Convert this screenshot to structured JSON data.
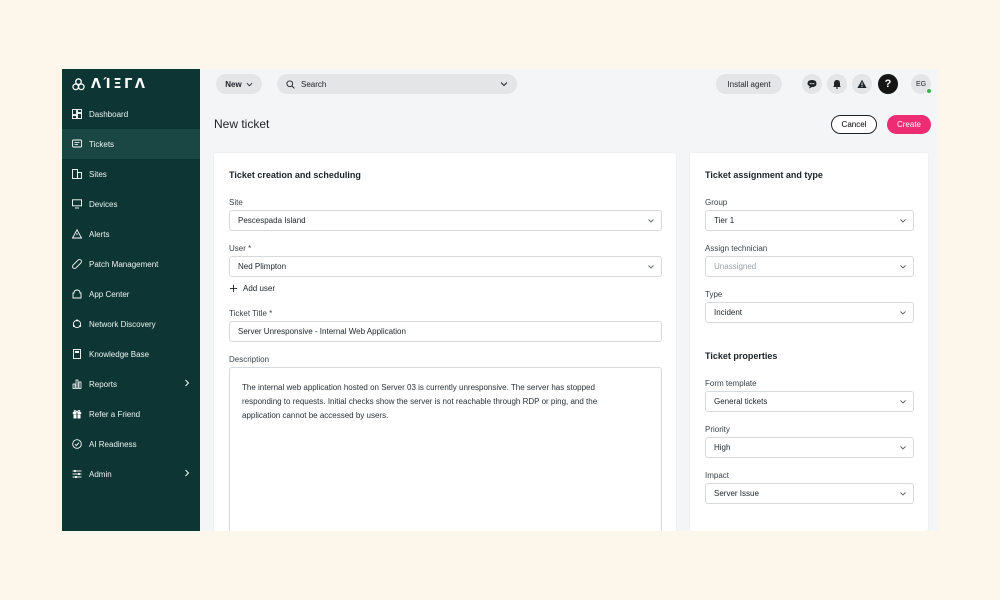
{
  "logo": {
    "text": "ΛΊΞΓΛ"
  },
  "sidebar": {
    "items": [
      {
        "label": "Dashboard",
        "icon": "dashboard-icon"
      },
      {
        "label": "Tickets",
        "icon": "ticket-icon"
      },
      {
        "label": "Sites",
        "icon": "sites-icon"
      },
      {
        "label": "Devices",
        "icon": "monitor-icon"
      },
      {
        "label": "Alerts",
        "icon": "alert-triangle-icon"
      },
      {
        "label": "Patch Management",
        "icon": "bandage-icon"
      },
      {
        "label": "App Center",
        "icon": "app-center-icon"
      },
      {
        "label": "Network Discovery",
        "icon": "network-icon"
      },
      {
        "label": "Knowledge Base",
        "icon": "book-icon"
      },
      {
        "label": "Reports",
        "icon": "reports-icon"
      },
      {
        "label": "Refer a Friend",
        "icon": "gift-icon"
      },
      {
        "label": "AI Readiness",
        "icon": "check-circle-icon"
      },
      {
        "label": "Admin",
        "icon": "sliders-icon"
      }
    ]
  },
  "topbar": {
    "new_label": "New",
    "search_label": "Search",
    "install_label": "Install agent",
    "help_label": "?",
    "avatar_initials": "EG"
  },
  "page": {
    "title": "New ticket",
    "cancel_label": "Cancel",
    "create_label": "Create"
  },
  "left_card": {
    "title": "Ticket creation and scheduling",
    "site_label": "Site",
    "site_value": "Pescespada Island",
    "user_label": "User *",
    "user_value": "Ned Plimpton",
    "add_user_label": "Add user",
    "ticket_title_label": "Ticket Title *",
    "ticket_title_value": "Server Unresponsive - Internal Web Application",
    "description_label": "Description",
    "description_lines": [
      "The internal web application hosted on Server 03 is currently unresponsive. The server has stopped",
      "responding to requests. Initial checks show the server is not reachable through RDP or ping, and the",
      "application cannot be accessed by users."
    ]
  },
  "right_card": {
    "title": "Ticket assignment and type",
    "group_label": "Group",
    "group_value": "Tier 1",
    "technician_label": "Assign technician",
    "technician_placeholder": "Unassigned",
    "type_label": "Type",
    "type_value": "Incident",
    "properties_title": "Ticket properties",
    "form_template_label": "Form template",
    "form_template_value": "General tickets",
    "priority_label": "Priority",
    "priority_value": "High",
    "impact_label": "Impact",
    "impact_value": "Server Issue"
  },
  "colors": {
    "sidebar_bg": "#0c3533",
    "sidebar_active": "#1a4744",
    "accent": "#ee2c74",
    "page_bg": "#fcf7ea",
    "status_online": "#37b24d"
  }
}
